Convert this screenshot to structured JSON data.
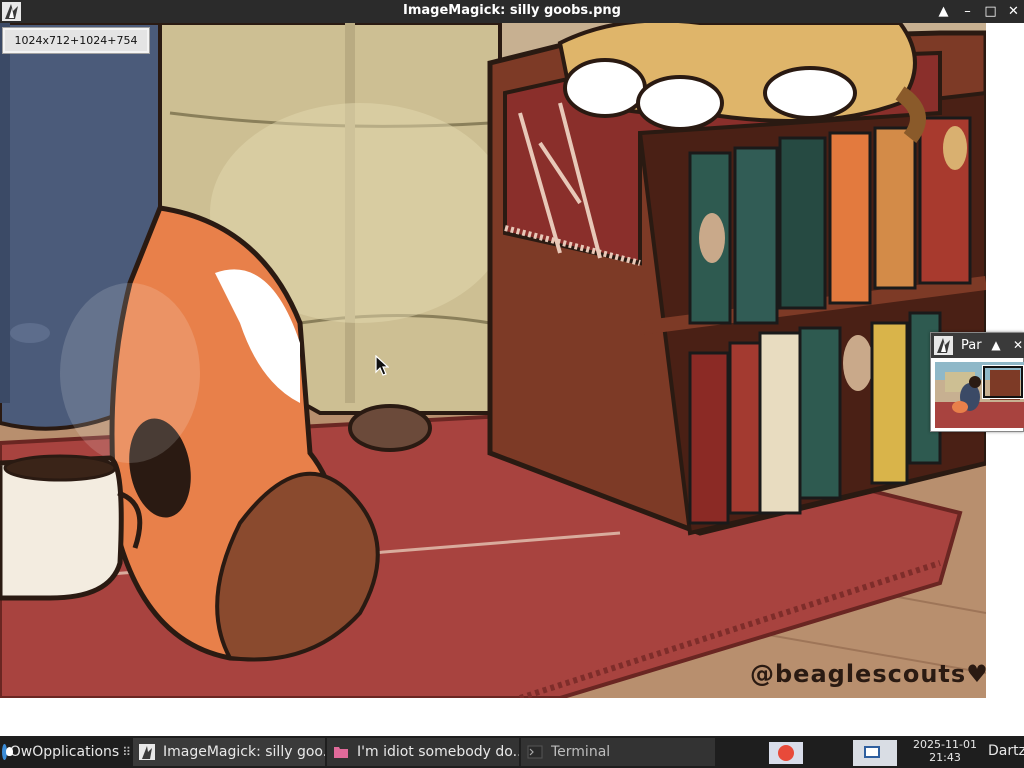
{
  "window": {
    "title": "ImageMagick: silly goobs.png",
    "app_icon": "imagemagick-wizard-icon",
    "controls": {
      "shade": "▲",
      "minimize": "–",
      "maximize": "□",
      "close": "✕"
    }
  },
  "viewer": {
    "geometry_label": "1024x712+1024+754",
    "watermark": "@beaglescouts",
    "watermark_heart": "♥"
  },
  "pan_window": {
    "title": "Par",
    "controls": {
      "shade": "▲",
      "close": "✕"
    }
  },
  "taskbar": {
    "start_label": "OwOpplications",
    "start_dots": "⠿",
    "tasks": [
      {
        "label": "ImageMagick: silly goo...",
        "icon": "imagemagick-wizard-icon"
      },
      {
        "label": "I'm idiot somebody do...",
        "icon": "folder-pink-icon"
      },
      {
        "label": "Terminal",
        "icon": "terminal-icon"
      }
    ],
    "clock": {
      "date": "2025-11-01",
      "time": "21:43"
    },
    "user": "Dartz"
  },
  "colors": {
    "titlebar": "#2b2b2b",
    "taskbar": "#1e1e1e",
    "rug": "#a8433f",
    "bookshelf": "#7d3a26",
    "fur_orange": "#e8804a"
  }
}
